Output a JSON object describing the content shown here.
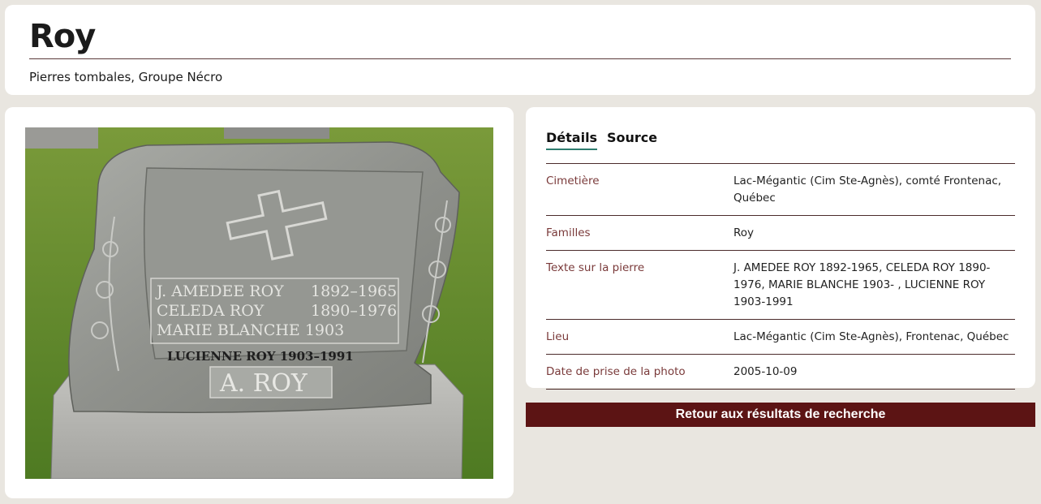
{
  "header": {
    "title": "Roy",
    "subtitle": "Pierres tombales, Groupe Nécro"
  },
  "photo": {
    "alt": "Pierre tombale A. ROY",
    "stone_lines": [
      {
        "name": "J. AMEDEE ROY",
        "dates": "1892–1965"
      },
      {
        "name": "CELEDA ROY",
        "dates": "1890–1976"
      },
      {
        "name": "MARIE BLANCHE",
        "dates": "1903"
      }
    ],
    "stone_footer": "LUCIENNE ROY 1903–1991",
    "stone_family": "A. ROY"
  },
  "tabs": [
    {
      "label": "Détails",
      "active": true
    },
    {
      "label": "Source",
      "active": false
    }
  ],
  "details": [
    {
      "label": "Cimetière",
      "value": "Lac-Mégantic (Cim Ste-Agnès), comté Frontenac, Québec"
    },
    {
      "label": "Familles",
      "value": "Roy"
    },
    {
      "label": "Texte sur la pierre",
      "value": "J. AMEDEE ROY 1892-1965, CELEDA ROY 1890-1976, MARIE BLANCHE 1903- , LUCIENNE ROY 1903-1991"
    },
    {
      "label": "Lieu",
      "value": "Lac-Mégantic (Cim Ste-Agnès), Frontenac, Québec"
    },
    {
      "label": "Date de prise de la photo",
      "value": "2005-10-09"
    }
  ],
  "back_button": {
    "label": "Retour aux résultats de recherche"
  },
  "colors": {
    "background": "#e9e6e0",
    "button": "#5c1414",
    "label": "#7a3a3a",
    "tab_underline": "#2e7d6f"
  }
}
